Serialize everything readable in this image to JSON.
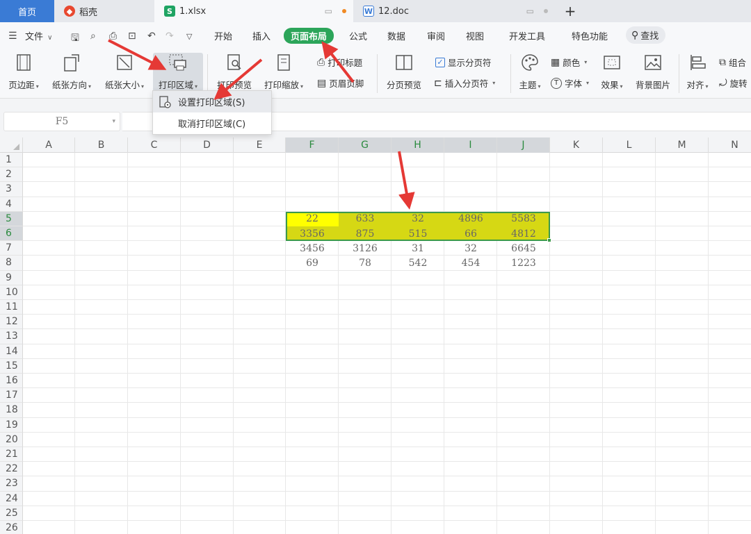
{
  "tabs": [
    {
      "label": "首页",
      "active": false
    },
    {
      "label": "稻壳",
      "icon": "docer-icon"
    },
    {
      "label": "1.xlsx",
      "icon": "sheet-icon",
      "active": true
    },
    {
      "label": "12.doc",
      "icon": "word-icon"
    }
  ],
  "new_tab_label": "+",
  "menu": {
    "file": "文件",
    "items": [
      "开始",
      "插入",
      "页面布局",
      "公式",
      "数据",
      "审阅",
      "视图",
      "开发工具",
      "特色功能"
    ],
    "active": "页面布局",
    "search": "查找"
  },
  "ribbon": {
    "margins": "页边距",
    "orientation": "纸张方向",
    "size": "纸张大小",
    "print_area": "打印区域",
    "print_preview": "打印预览",
    "print_scale": "打印缩放",
    "print_titles": "打印标题",
    "header_footer": "页眉页脚",
    "page_break_preview": "分页预览",
    "show_page_breaks": "显示分页符",
    "insert_page_break": "插入分页符",
    "theme": "主题",
    "colors": "颜色",
    "fonts": "字体",
    "effects": "效果",
    "background": "背景图片",
    "align": "对齐",
    "group": "组合",
    "rotate": "旋转"
  },
  "dropdown": {
    "set_print_area": "设置打印区域(S)",
    "clear_print_area": "取消打印区域(C)"
  },
  "name_box": "F5",
  "columns": [
    "A",
    "B",
    "C",
    "D",
    "E",
    "F",
    "G",
    "H",
    "I",
    "J",
    "K",
    "L",
    "M",
    "N"
  ],
  "selected_columns": [
    "F",
    "G",
    "H",
    "I",
    "J"
  ],
  "rows": [
    "1",
    "2",
    "3",
    "4",
    "5",
    "6",
    "7",
    "8",
    "9",
    "10",
    "11",
    "12",
    "13",
    "14",
    "15",
    "16",
    "17",
    "18",
    "19",
    "20",
    "21",
    "22",
    "23",
    "24",
    "25",
    "26"
  ],
  "selected_rows": [
    "5",
    "6"
  ],
  "cells": {
    "r5": [
      "22",
      "633",
      "32",
      "4896",
      "5583"
    ],
    "r6": [
      "3356",
      "875",
      "515",
      "66",
      "4812"
    ],
    "r7": [
      "3456",
      "3126",
      "31",
      "32",
      "6645"
    ],
    "r8": [
      "69",
      "78",
      "542",
      "454",
      "1223"
    ]
  },
  "colors": {
    "accent_green": "#2ca55a",
    "selection_fill": "#d6d814",
    "active_cell": "#ffff00",
    "arrow_red": "#e53935"
  }
}
